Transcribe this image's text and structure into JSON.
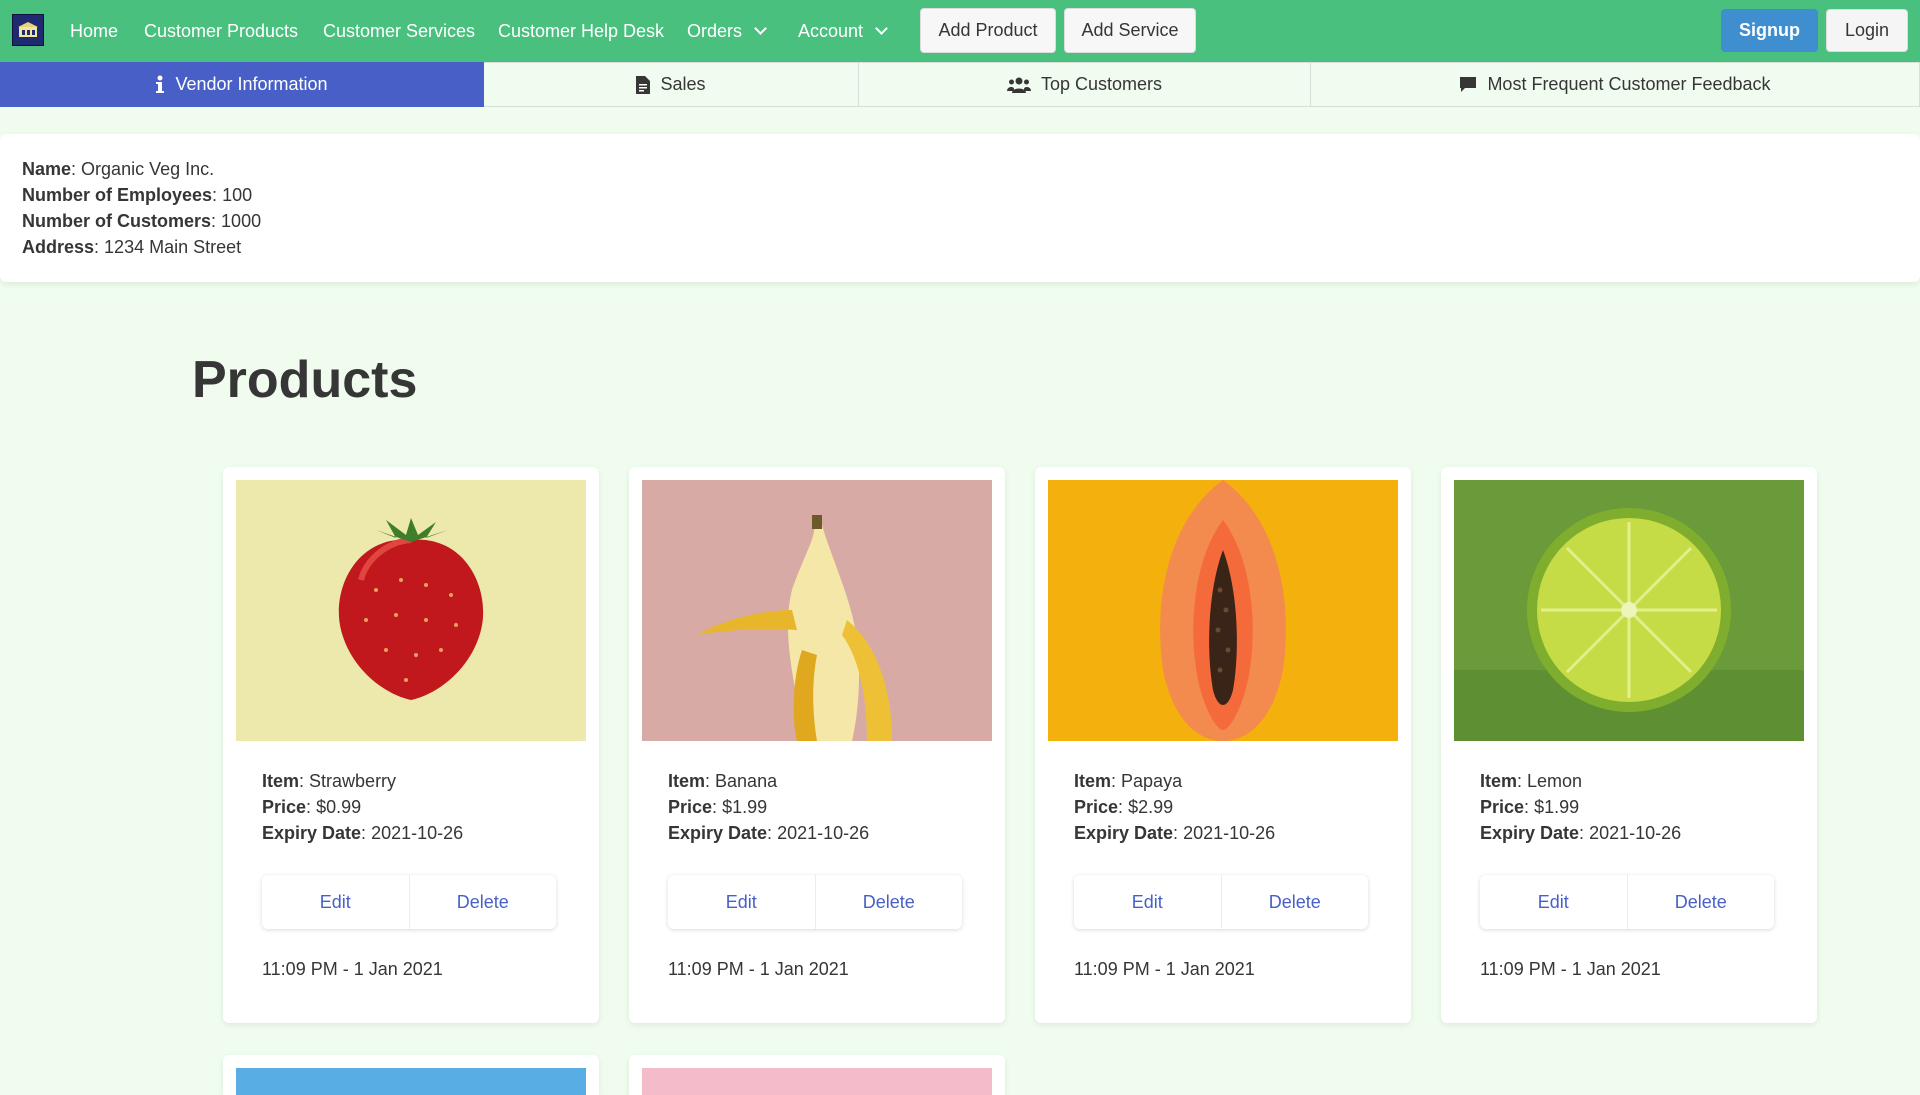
{
  "navbar": {
    "home": "Home",
    "customer_products": "Customer Products",
    "customer_services": "Customer Services",
    "customer_help_desk": "Customer Help Desk",
    "orders": "Orders",
    "account": "Account",
    "add_product": "Add Product",
    "add_service": "Add Service",
    "signup": "Signup",
    "login": "Login",
    "colors": {
      "bar": "#4ac07e",
      "signup": "#3e8ed0",
      "logo_bg": "#1f2a70"
    }
  },
  "tabs": [
    {
      "label": "Vendor Information",
      "icon": "info-icon"
    },
    {
      "label": "Sales",
      "icon": "file-invoice-icon"
    },
    {
      "label": "Top Customers",
      "icon": "users-icon"
    },
    {
      "label": "Most Frequent Customer Feedback",
      "icon": "comment-icon"
    }
  ],
  "vendor": {
    "name_label": "Name",
    "name": "Organic Veg Inc.",
    "employees_label": "Number of Employees",
    "employees": "100",
    "customers_label": "Number of Customers",
    "customers": "1000",
    "address_label": "Address",
    "address": "1234 Main Street"
  },
  "products_title": "Products",
  "labels": {
    "item": "Item",
    "price": "Price",
    "expiry": "Expiry Date",
    "edit": "Edit",
    "delete": "Delete"
  },
  "products": [
    {
      "item": "Strawberry",
      "price": "$0.99",
      "expiry": "2021-10-26",
      "time": "11:09 PM - 1 Jan 2021",
      "image": "strawberry-image",
      "bg": "#ede9ac"
    },
    {
      "item": "Banana",
      "price": "$1.99",
      "expiry": "2021-10-26",
      "time": "11:09 PM - 1 Jan 2021",
      "image": "banana-image",
      "bg": "#d8aaa6"
    },
    {
      "item": "Papaya",
      "price": "$2.99",
      "expiry": "2021-10-26",
      "time": "11:09 PM - 1 Jan 2021",
      "image": "papaya-image",
      "bg": "#f4b00d"
    },
    {
      "item": "Lemon",
      "price": "$1.99",
      "expiry": "2021-10-26",
      "time": "11:09 PM - 1 Jan 2021",
      "image": "lime-image",
      "bg": "#6a9a3a"
    }
  ],
  "partial_cards": [
    {
      "image": "blue-image",
      "bg": "#58aee4"
    },
    {
      "image": "pink-image",
      "bg": "#f4bccb"
    }
  ]
}
